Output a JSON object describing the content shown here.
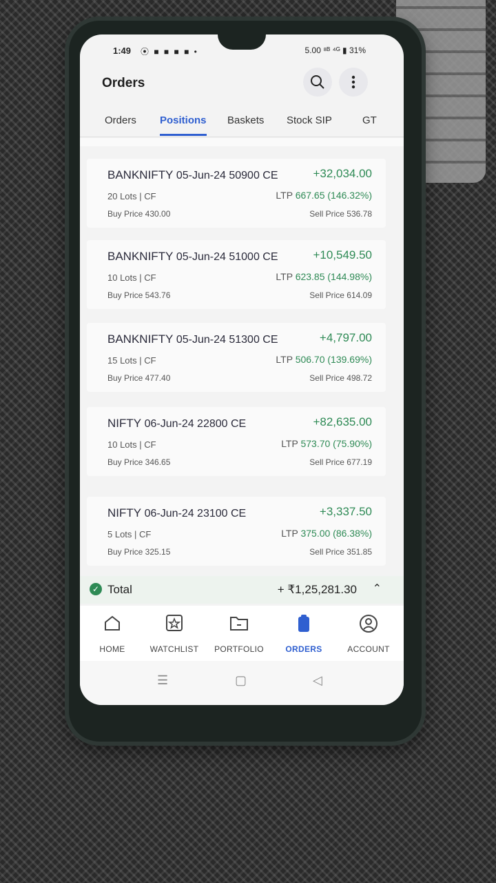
{
  "status_bar": {
    "time": "1:49",
    "icons": "⦿ ■ ■ ■ ■ •",
    "right": "5.00 ⁸ᴮ ⁴ᴳ ▮ 31%"
  },
  "header": {
    "title": "Orders",
    "search_icon": "search-icon",
    "menu_icon": "more-vertical-icon"
  },
  "tabs": [
    {
      "label": "Orders"
    },
    {
      "label": "Positions",
      "active": true
    },
    {
      "label": "Baskets"
    },
    {
      "label": "Stock SIP"
    },
    {
      "label": "GT"
    }
  ],
  "positions": [
    {
      "symbol": "BANKNIFTY",
      "contract": "05-Jun-24 50900 CE",
      "pnl": "+32,034.00",
      "lots": "20 Lots | CF",
      "ltp_label": "LTP",
      "ltp": "667.65 (146.32%)",
      "buy": "Buy Price 430.00",
      "sell": "Sell Price 536.78"
    },
    {
      "symbol": "BANKNIFTY",
      "contract": "05-Jun-24 51000 CE",
      "pnl": "+10,549.50",
      "lots": "10 Lots | CF",
      "ltp_label": "LTP",
      "ltp": "623.85 (144.98%)",
      "buy": "Buy Price 543.76",
      "sell": "Sell Price 614.09"
    },
    {
      "symbol": "BANKNIFTY",
      "contract": "05-Jun-24 51300 CE",
      "pnl": "+4,797.00",
      "lots": "15 Lots | CF",
      "ltp_label": "LTP",
      "ltp": "506.70 (139.69%)",
      "buy": "Buy Price 477.40",
      "sell": "Sell Price 498.72"
    },
    {
      "symbol": "NIFTY",
      "contract": "06-Jun-24 22800 CE",
      "pnl": "+82,635.00",
      "lots": "10 Lots | CF",
      "ltp_label": "LTP",
      "ltp": "573.70 (75.90%)",
      "buy": "Buy Price 346.65",
      "sell": "Sell Price 677.19"
    },
    {
      "symbol": "NIFTY",
      "contract": "06-Jun-24 23100 CE",
      "pnl": "+3,337.50",
      "lots": "5 Lots | CF",
      "ltp_label": "LTP",
      "ltp": "375.00 (86.38%)",
      "buy": "Buy Price 325.15",
      "sell": "Sell Price 351.85"
    }
  ],
  "total": {
    "label": "Total",
    "value": "+ ₹1,25,281.30"
  },
  "bottom_nav": [
    {
      "label": "HOME",
      "icon": "home-icon"
    },
    {
      "label": "WATCHLIST",
      "icon": "star-icon"
    },
    {
      "label": "PORTFOLIO",
      "icon": "folder-icon"
    },
    {
      "label": "ORDERS",
      "icon": "clipboard-icon",
      "active": true
    },
    {
      "label": "ACCOUNT",
      "icon": "user-icon"
    }
  ],
  "gesture_bar": {
    "menu": "☰",
    "home": "▢",
    "back": "◁"
  },
  "colors": {
    "accent": "#2f5fd0",
    "profit": "#2e8a55"
  }
}
